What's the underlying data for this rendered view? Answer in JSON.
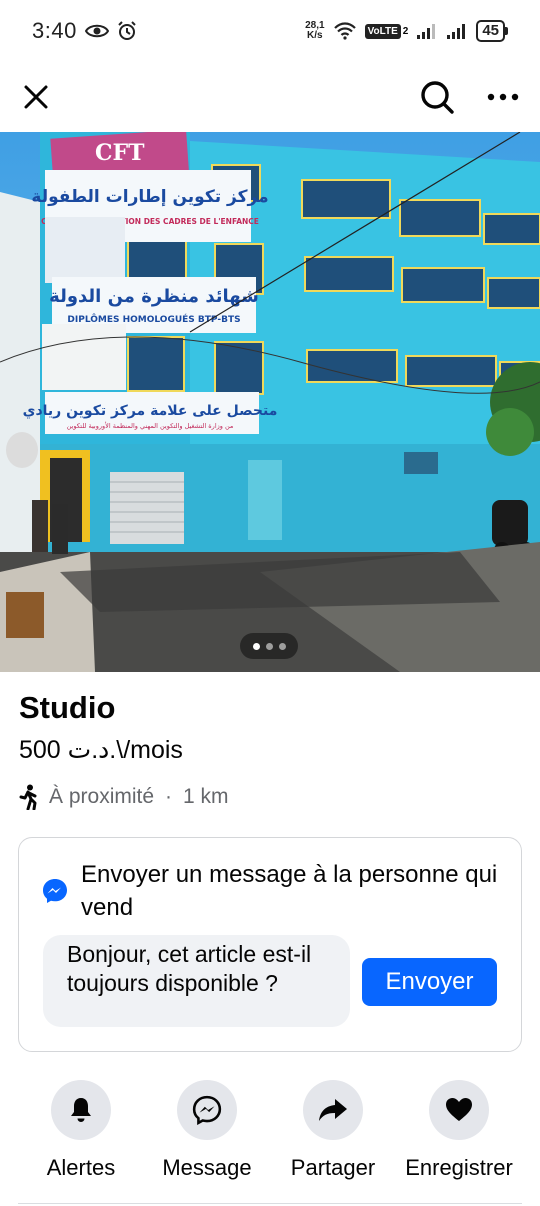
{
  "status_bar": {
    "time": "3:40",
    "net_speed_value": "28,1",
    "net_speed_unit": "K/s",
    "volte": "VoLTE",
    "volte_sim": "2",
    "battery": "45"
  },
  "top_nav": {
    "close_icon": "close-icon",
    "search_icon": "search-icon",
    "more_icon": "more-icon"
  },
  "photo": {
    "sign_logo": "CFT",
    "sign1_ar": "مركز تكوين إطارات الطفولة",
    "sign1_fr": "CENTRE DE FORMATION DES CADRES DE L'ENFANCE",
    "sign2_ar": "شهائد منظرة من الدولة",
    "sign2_fr": "DIPLÔMES HOMOLOGUÉS BTP-BTS",
    "sign3_ar": "متحصل على علامة مركز تكوين ريادي",
    "sign3_sub": "من وزارة التشغيل والتكوين المهني والمنظمة الأوروبية للتكوين",
    "slide_count": 3,
    "active_slide": 1
  },
  "listing": {
    "title": "Studio",
    "price": "500 د.ت.\\/mois",
    "distance_label": "À proximité",
    "distance_sep": "·",
    "distance_value": "1 km"
  },
  "message_card": {
    "heading": "Envoyer un message à la personne qui vend",
    "input_value": "Bonjour, cet article est-il toujours disponible ?",
    "send_label": "Envoyer"
  },
  "actions": [
    {
      "label": "Alertes",
      "icon": "bell-icon"
    },
    {
      "label": "Message",
      "icon": "messenger-icon"
    },
    {
      "label": "Partager",
      "icon": "share-icon"
    },
    {
      "label": "Enregistrer",
      "icon": "heart-icon"
    }
  ],
  "colors": {
    "accent": "#0866ff",
    "secondary_text": "#65676b",
    "action_circle": "#e4e6eb",
    "input_bg": "#f0f2f5"
  }
}
